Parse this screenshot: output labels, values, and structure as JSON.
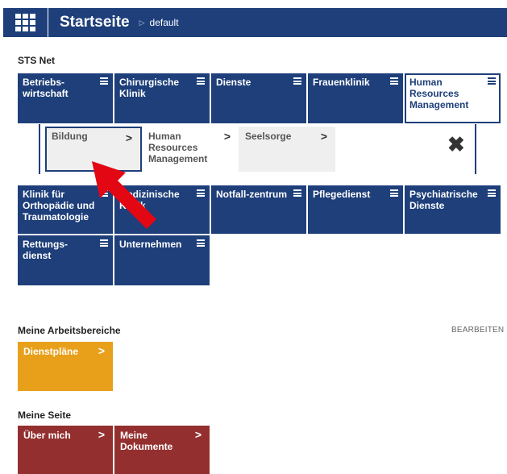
{
  "header": {
    "title": "Startseite",
    "breadcrumb": "default",
    "breadcrumb_separator": "▷",
    "color": "#1e3f7a"
  },
  "sts_net": {
    "title": "STS Net",
    "tiles": [
      {
        "label": "Betriebs-wirtschaft"
      },
      {
        "label": "Chirurgische Klinik"
      },
      {
        "label": "Dienste"
      },
      {
        "label": "Frauenklinik"
      },
      {
        "label": "Human Resources Management",
        "active": true
      },
      {
        "label": "Klinik für Orthopädie und Traumatologie"
      },
      {
        "label": "Medizinische Klinik"
      },
      {
        "label": "Notfall-zentrum"
      },
      {
        "label": "Pflegedienst"
      },
      {
        "label": "Psychiatrische Dienste"
      },
      {
        "label": "Rettungs-dienst"
      },
      {
        "label": "Unternehmen"
      }
    ],
    "subitems": [
      {
        "label": "Bildung",
        "selected": true
      },
      {
        "label": "Human Resources Management"
      },
      {
        "label": "Seelsorge"
      }
    ],
    "chevron": ">",
    "close_icon": "close-icon"
  },
  "arbeitsbereiche": {
    "title": "Meine Arbeitsbereiche",
    "edit_label": "BEARBEITEN",
    "tiles": [
      {
        "label": "Dienstpläne",
        "color": "#e8a01b"
      }
    ]
  },
  "meine_seite": {
    "title": "Meine Seite",
    "tiles": [
      {
        "label": "Über mich",
        "color": "#93302f"
      },
      {
        "label": "Meine Dokumente",
        "color": "#93302f"
      }
    ]
  },
  "annotation": {
    "color": "#e30613",
    "icon": "red-arrow-icon"
  }
}
